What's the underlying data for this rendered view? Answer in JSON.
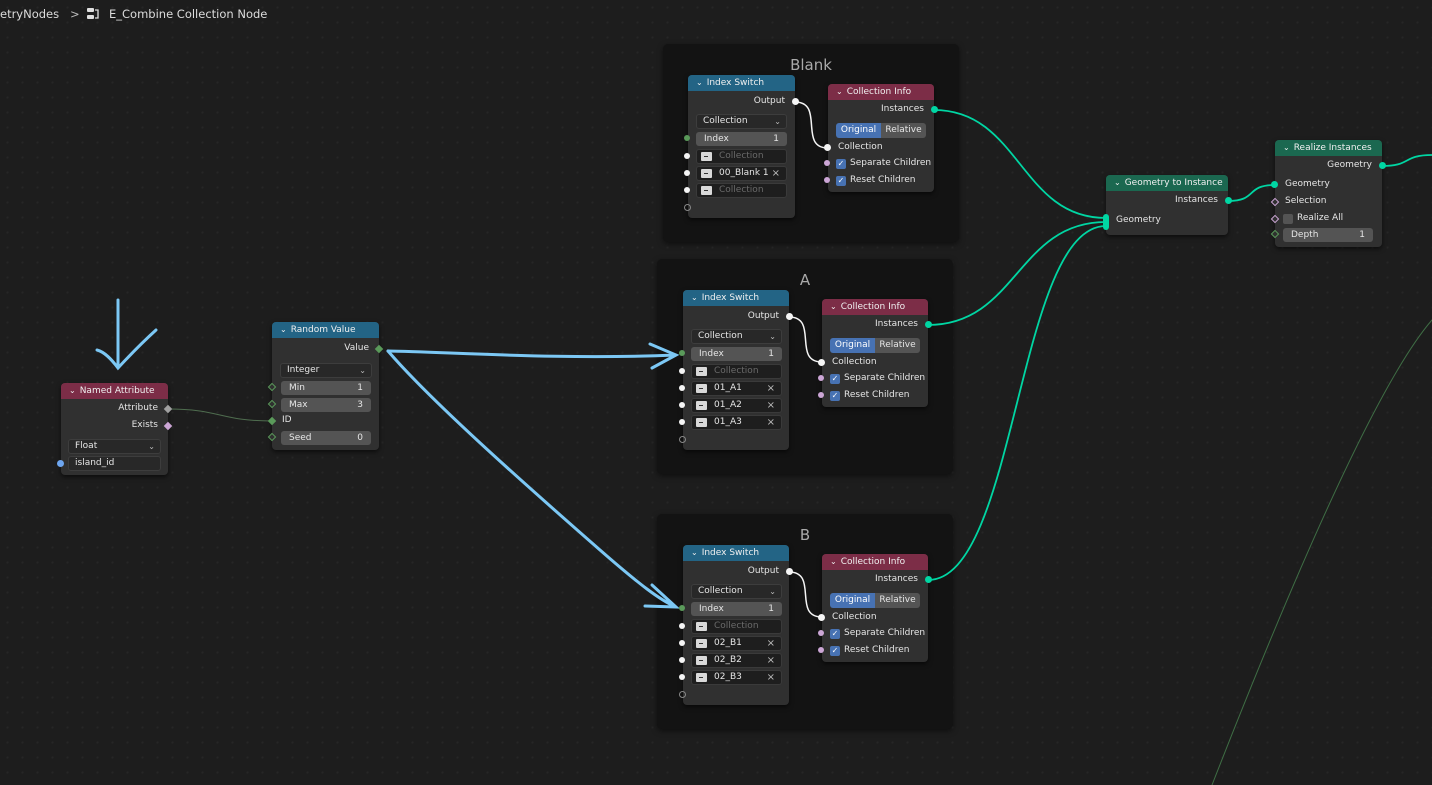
{
  "breadcrumb": {
    "parent": "etryNodes",
    "separator": ">",
    "icon": "node-tree-icon",
    "current": "E_Combine Collection Node"
  },
  "frames": [
    {
      "title": "Blank"
    },
    {
      "title": "A"
    },
    {
      "title": "B"
    }
  ],
  "colors": {
    "geometry_wire": "#00d6a3",
    "annotation_arrow": "#7cc8f5",
    "collection_socket": "#f5f5f5",
    "int_socket": "#5a9a5a",
    "bool_socket": "#cca6d6",
    "string_socket": "#6ea6f0",
    "header_blue": "#236485",
    "header_red": "#7c2d47",
    "header_green": "#1b6850",
    "toggle_active": "#4772b3"
  },
  "named_attribute": {
    "title": "Named Attribute",
    "outputs": [
      "Attribute",
      "Exists"
    ],
    "type": "Float",
    "name": "island_id"
  },
  "random_value": {
    "title": "Random Value",
    "output": "Value",
    "type": "Integer",
    "min_label": "Min",
    "min": "1",
    "max_label": "Max",
    "max": "3",
    "id_label": "ID",
    "seed_label": "Seed",
    "seed": "0"
  },
  "index_switches": [
    {
      "title": "Index Switch",
      "output": "Output",
      "type": "Collection",
      "index_label": "Index",
      "index": "1",
      "items": [
        {
          "name": "Collection",
          "empty": true
        },
        {
          "name": "00_Blank 1",
          "empty": false
        },
        {
          "name": "Collection",
          "empty": true
        }
      ]
    },
    {
      "title": "Index Switch",
      "output": "Output",
      "type": "Collection",
      "index_label": "Index",
      "index": "1",
      "items": [
        {
          "name": "Collection",
          "empty": true
        },
        {
          "name": "01_A1",
          "empty": false
        },
        {
          "name": "01_A2",
          "empty": false
        },
        {
          "name": "01_A3",
          "empty": false
        }
      ]
    },
    {
      "title": "Index Switch",
      "output": "Output",
      "type": "Collection",
      "index_label": "Index",
      "index": "1",
      "items": [
        {
          "name": "Collection",
          "empty": true
        },
        {
          "name": "02_B1",
          "empty": false
        },
        {
          "name": "02_B2",
          "empty": false
        },
        {
          "name": "02_B3",
          "empty": false
        }
      ]
    }
  ],
  "collection_info": {
    "title": "Collection Info",
    "output": "Instances",
    "mode_options": [
      "Original",
      "Relative"
    ],
    "mode_selected": "Original",
    "input": "Collection",
    "separate_children_label": "Separate Children",
    "separate_children": true,
    "reset_children_label": "Reset Children",
    "reset_children": true
  },
  "geometry_to_instance": {
    "title": "Geometry to Instance",
    "output": "Instances",
    "input": "Geometry"
  },
  "realize_instances": {
    "title": "Realize Instances",
    "output": "Geometry",
    "input_geometry": "Geometry",
    "selection": "Selection",
    "realize_all_label": "Realize All",
    "realize_all": false,
    "depth_label": "Depth",
    "depth": "1"
  }
}
